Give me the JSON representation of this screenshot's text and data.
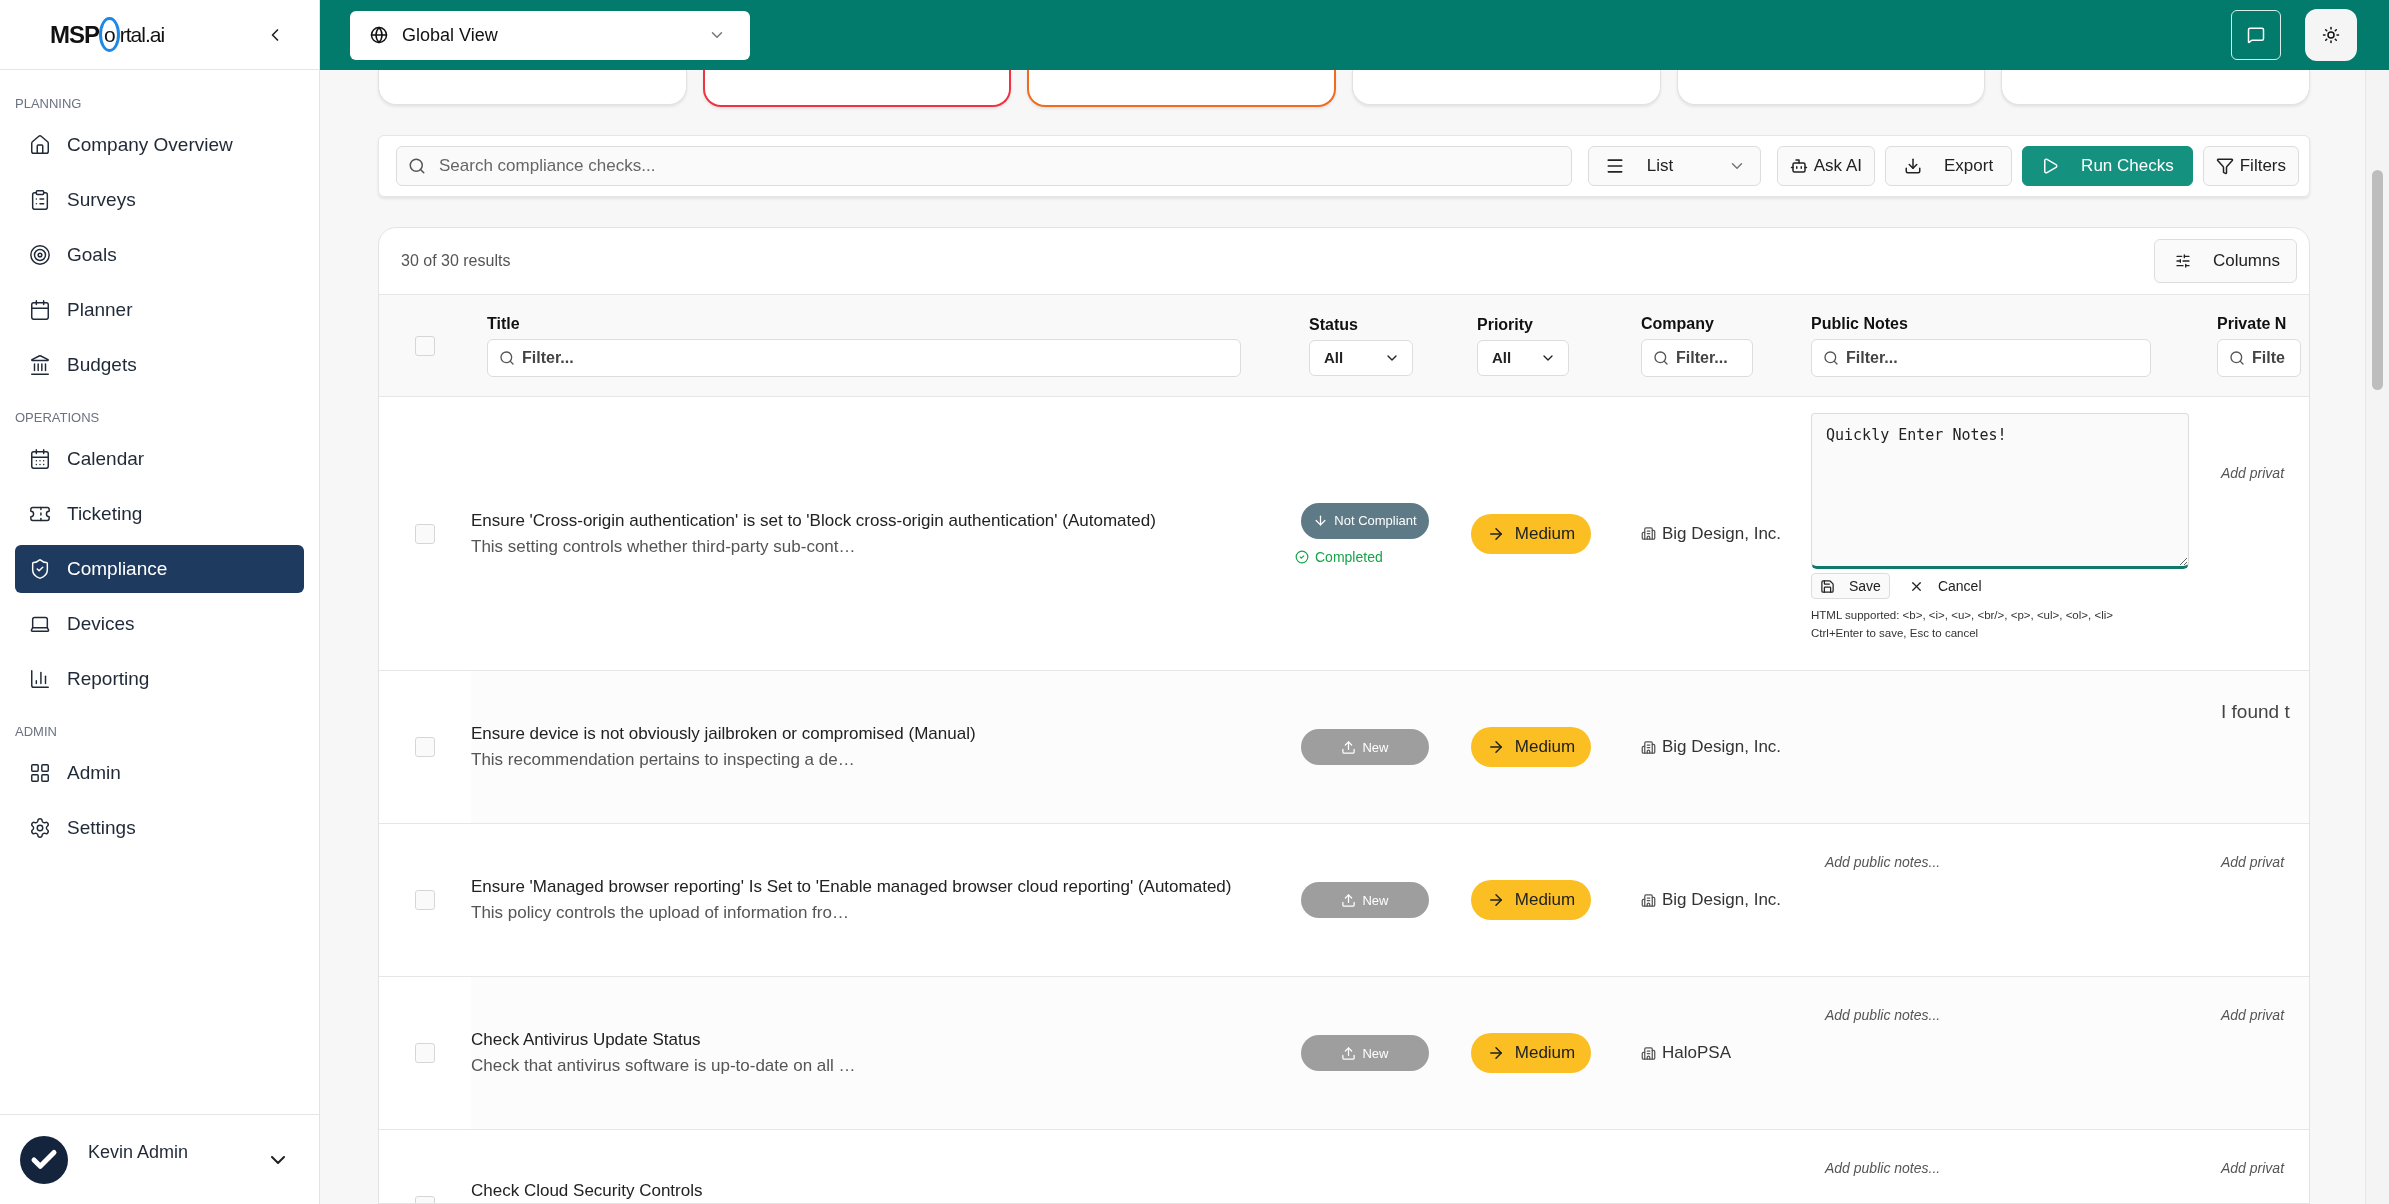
{
  "header": {
    "scope": {
      "value": "Global View"
    }
  },
  "sidebar": {
    "logo": {
      "lead": "MSP",
      "ring": "o",
      "rest": "rtal.ai"
    },
    "sections": [
      {
        "label": "PLANNING",
        "items": [
          {
            "label": "Company Overview",
            "selected": false
          },
          {
            "label": "Surveys",
            "selected": false
          },
          {
            "label": "Goals",
            "selected": false
          },
          {
            "label": "Planner",
            "selected": false
          },
          {
            "label": "Budgets",
            "selected": false
          }
        ]
      },
      {
        "label": "OPERATIONS",
        "items": [
          {
            "label": "Calendar",
            "selected": false
          },
          {
            "label": "Ticketing",
            "selected": false
          },
          {
            "label": "Compliance",
            "selected": true
          },
          {
            "label": "Devices",
            "selected": false
          },
          {
            "label": "Reporting",
            "selected": false
          }
        ]
      },
      {
        "label": "ADMIN",
        "items": [
          {
            "label": "Admin",
            "selected": false
          },
          {
            "label": "Settings",
            "selected": false
          }
        ]
      }
    ],
    "user": {
      "name": "Kevin Admin"
    }
  },
  "stat_cards": [
    {
      "kind": "plain"
    },
    {
      "kind": "alert"
    },
    {
      "kind": "warning"
    },
    {
      "kind": "plain"
    },
    {
      "kind": "plain"
    },
    {
      "kind": "plain"
    }
  ],
  "toolbar": {
    "search": {
      "placeholder": "Search compliance checks..."
    },
    "view": {
      "value": "List"
    },
    "buttons": [
      {
        "label": "Ask AI",
        "kind": "ai"
      },
      {
        "label": "Export",
        "kind": "export"
      },
      {
        "label": "Run Checks",
        "kind": "primary"
      },
      {
        "label": "Filters",
        "kind": "filter"
      }
    ]
  },
  "table": {
    "result_count": "30 of 30 results",
    "columns_button": "Columns",
    "select_all": {
      "checked": false
    },
    "columns": [
      {
        "label": "Title",
        "filter": {
          "kind": "text",
          "placeholder": "Filter..."
        }
      },
      {
        "label": "Status",
        "filter": {
          "kind": "select",
          "value": "All"
        }
      },
      {
        "label": "Priority",
        "filter": {
          "kind": "select",
          "value": "All"
        }
      },
      {
        "label": "Company",
        "filter": {
          "kind": "text",
          "placeholder": "Filter..."
        }
      },
      {
        "label": "Public Notes",
        "filter": {
          "kind": "text",
          "placeholder": "Filter..."
        }
      },
      {
        "label": "Private N",
        "filter": {
          "kind": "text",
          "placeholder": "Filte"
        }
      }
    ],
    "rows": [
      {
        "checked": false,
        "title": "Ensure 'Cross-origin authentication' is set to 'Block cross-origin authentication' (Automated)",
        "description": "This setting controls whether third-party sub-cont…",
        "status": {
          "kind": "not_compliant",
          "label": "Not Compliant"
        },
        "completion": "Completed",
        "priority": "Medium",
        "company": "Big Design, Inc.",
        "public_notes": {
          "kind": "editor",
          "value": "Quickly Enter Notes!",
          "save": "Save",
          "cancel": "Cancel",
          "hints": [
            "HTML supported: <b>, <i>, <u>, <br/>, <p>, <ul>, <ol>, <li>",
            "Ctrl+Enter to save, Esc to cancel"
          ]
        },
        "private_notes": {
          "kind": "placeholder",
          "text": "Add privat"
        }
      },
      {
        "checked": false,
        "title": "Ensure device is not obviously jailbroken or compromised (Manual)",
        "description": "This recommendation pertains to inspecting a de…",
        "status": {
          "kind": "new",
          "label": "New"
        },
        "priority": "Medium",
        "company": "Big Design, Inc.",
        "private_notes": {
          "kind": "note",
          "text": "I found t"
        }
      },
      {
        "checked": false,
        "title": "Ensure 'Managed browser reporting' Is Set to 'Enable managed browser cloud reporting' (Automated)",
        "description": "This policy controls the upload of information fro…",
        "status": {
          "kind": "new",
          "label": "New"
        },
        "priority": "Medium",
        "company": "Big Design, Inc.",
        "public_notes": {
          "kind": "placeholder",
          "text": "Add public notes..."
        },
        "private_notes": {
          "kind": "placeholder",
          "text": "Add privat"
        }
      },
      {
        "checked": false,
        "title": "Check Antivirus Update Status",
        "description": "Check that antivirus software is up-to-date on all …",
        "status": {
          "kind": "new",
          "label": "New"
        },
        "priority": "Medium",
        "company": "HaloPSA",
        "public_notes": {
          "kind": "placeholder",
          "text": "Add public notes..."
        },
        "private_notes": {
          "kind": "placeholder",
          "text": "Add privat"
        }
      },
      {
        "checked": false,
        "title": "Check Cloud Security Controls",
        "public_notes": {
          "kind": "placeholder",
          "text": "Add public notes..."
        },
        "private_notes": {
          "kind": "placeholder",
          "text": "Add privat"
        }
      }
    ]
  }
}
